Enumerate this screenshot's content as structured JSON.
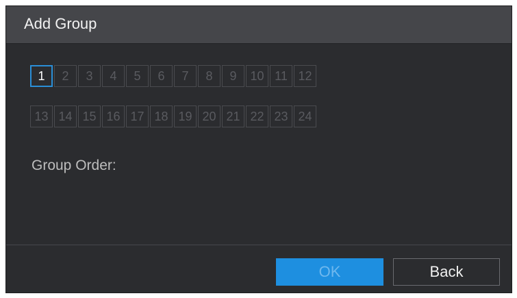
{
  "dialog": {
    "title": "Add Group",
    "channels_row1": [
      "1",
      "2",
      "3",
      "4",
      "5",
      "6",
      "7",
      "8",
      "9",
      "10",
      "11",
      "12"
    ],
    "channels_row2": [
      "13",
      "14",
      "15",
      "16",
      "17",
      "18",
      "19",
      "20",
      "21",
      "22",
      "23",
      "24"
    ],
    "selected_channel": "1",
    "group_order_label": "Group Order:",
    "ok_label": "OK",
    "back_label": "Back"
  },
  "colors": {
    "dialog_bg": "#2b2c2f",
    "titlebar_bg": "#45464a",
    "accent": "#1e8fe0",
    "selected_border": "#2a8fd8"
  }
}
